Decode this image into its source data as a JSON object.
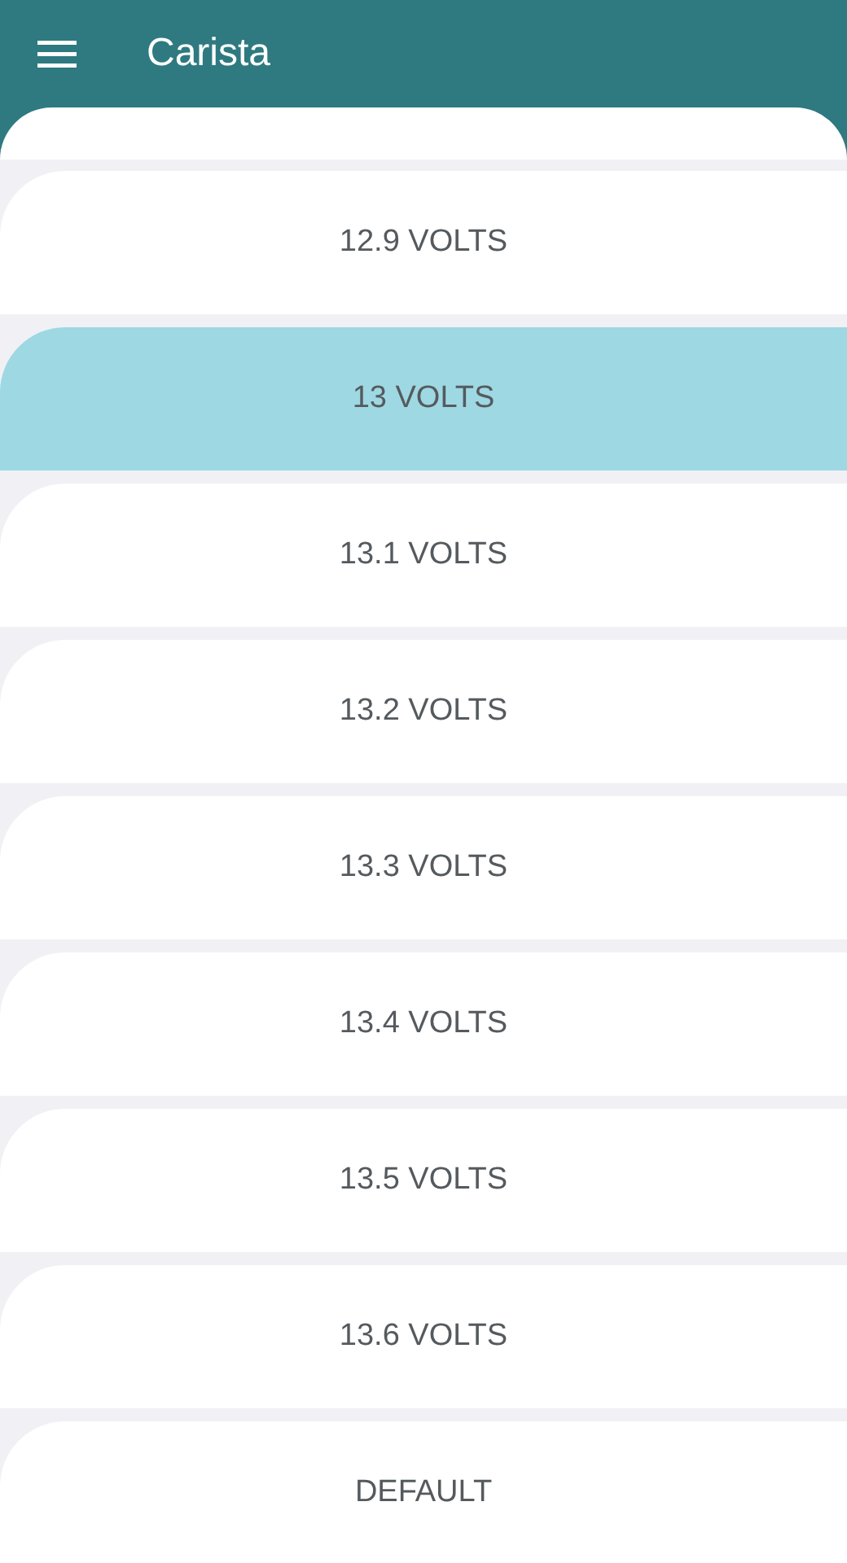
{
  "app_bar": {
    "title": "Carista"
  },
  "options": [
    {
      "label": "12.9 VOLTS",
      "selected": false
    },
    {
      "label": "13 VOLTS",
      "selected": true
    },
    {
      "label": "13.1 VOLTS",
      "selected": false
    },
    {
      "label": "13.2 VOLTS",
      "selected": false
    },
    {
      "label": "13.3 VOLTS",
      "selected": false
    },
    {
      "label": "13.4 VOLTS",
      "selected": false
    },
    {
      "label": "13.5 VOLTS",
      "selected": false
    },
    {
      "label": "13.6 VOLTS",
      "selected": false
    },
    {
      "label": "DEFAULT",
      "selected": false
    }
  ]
}
